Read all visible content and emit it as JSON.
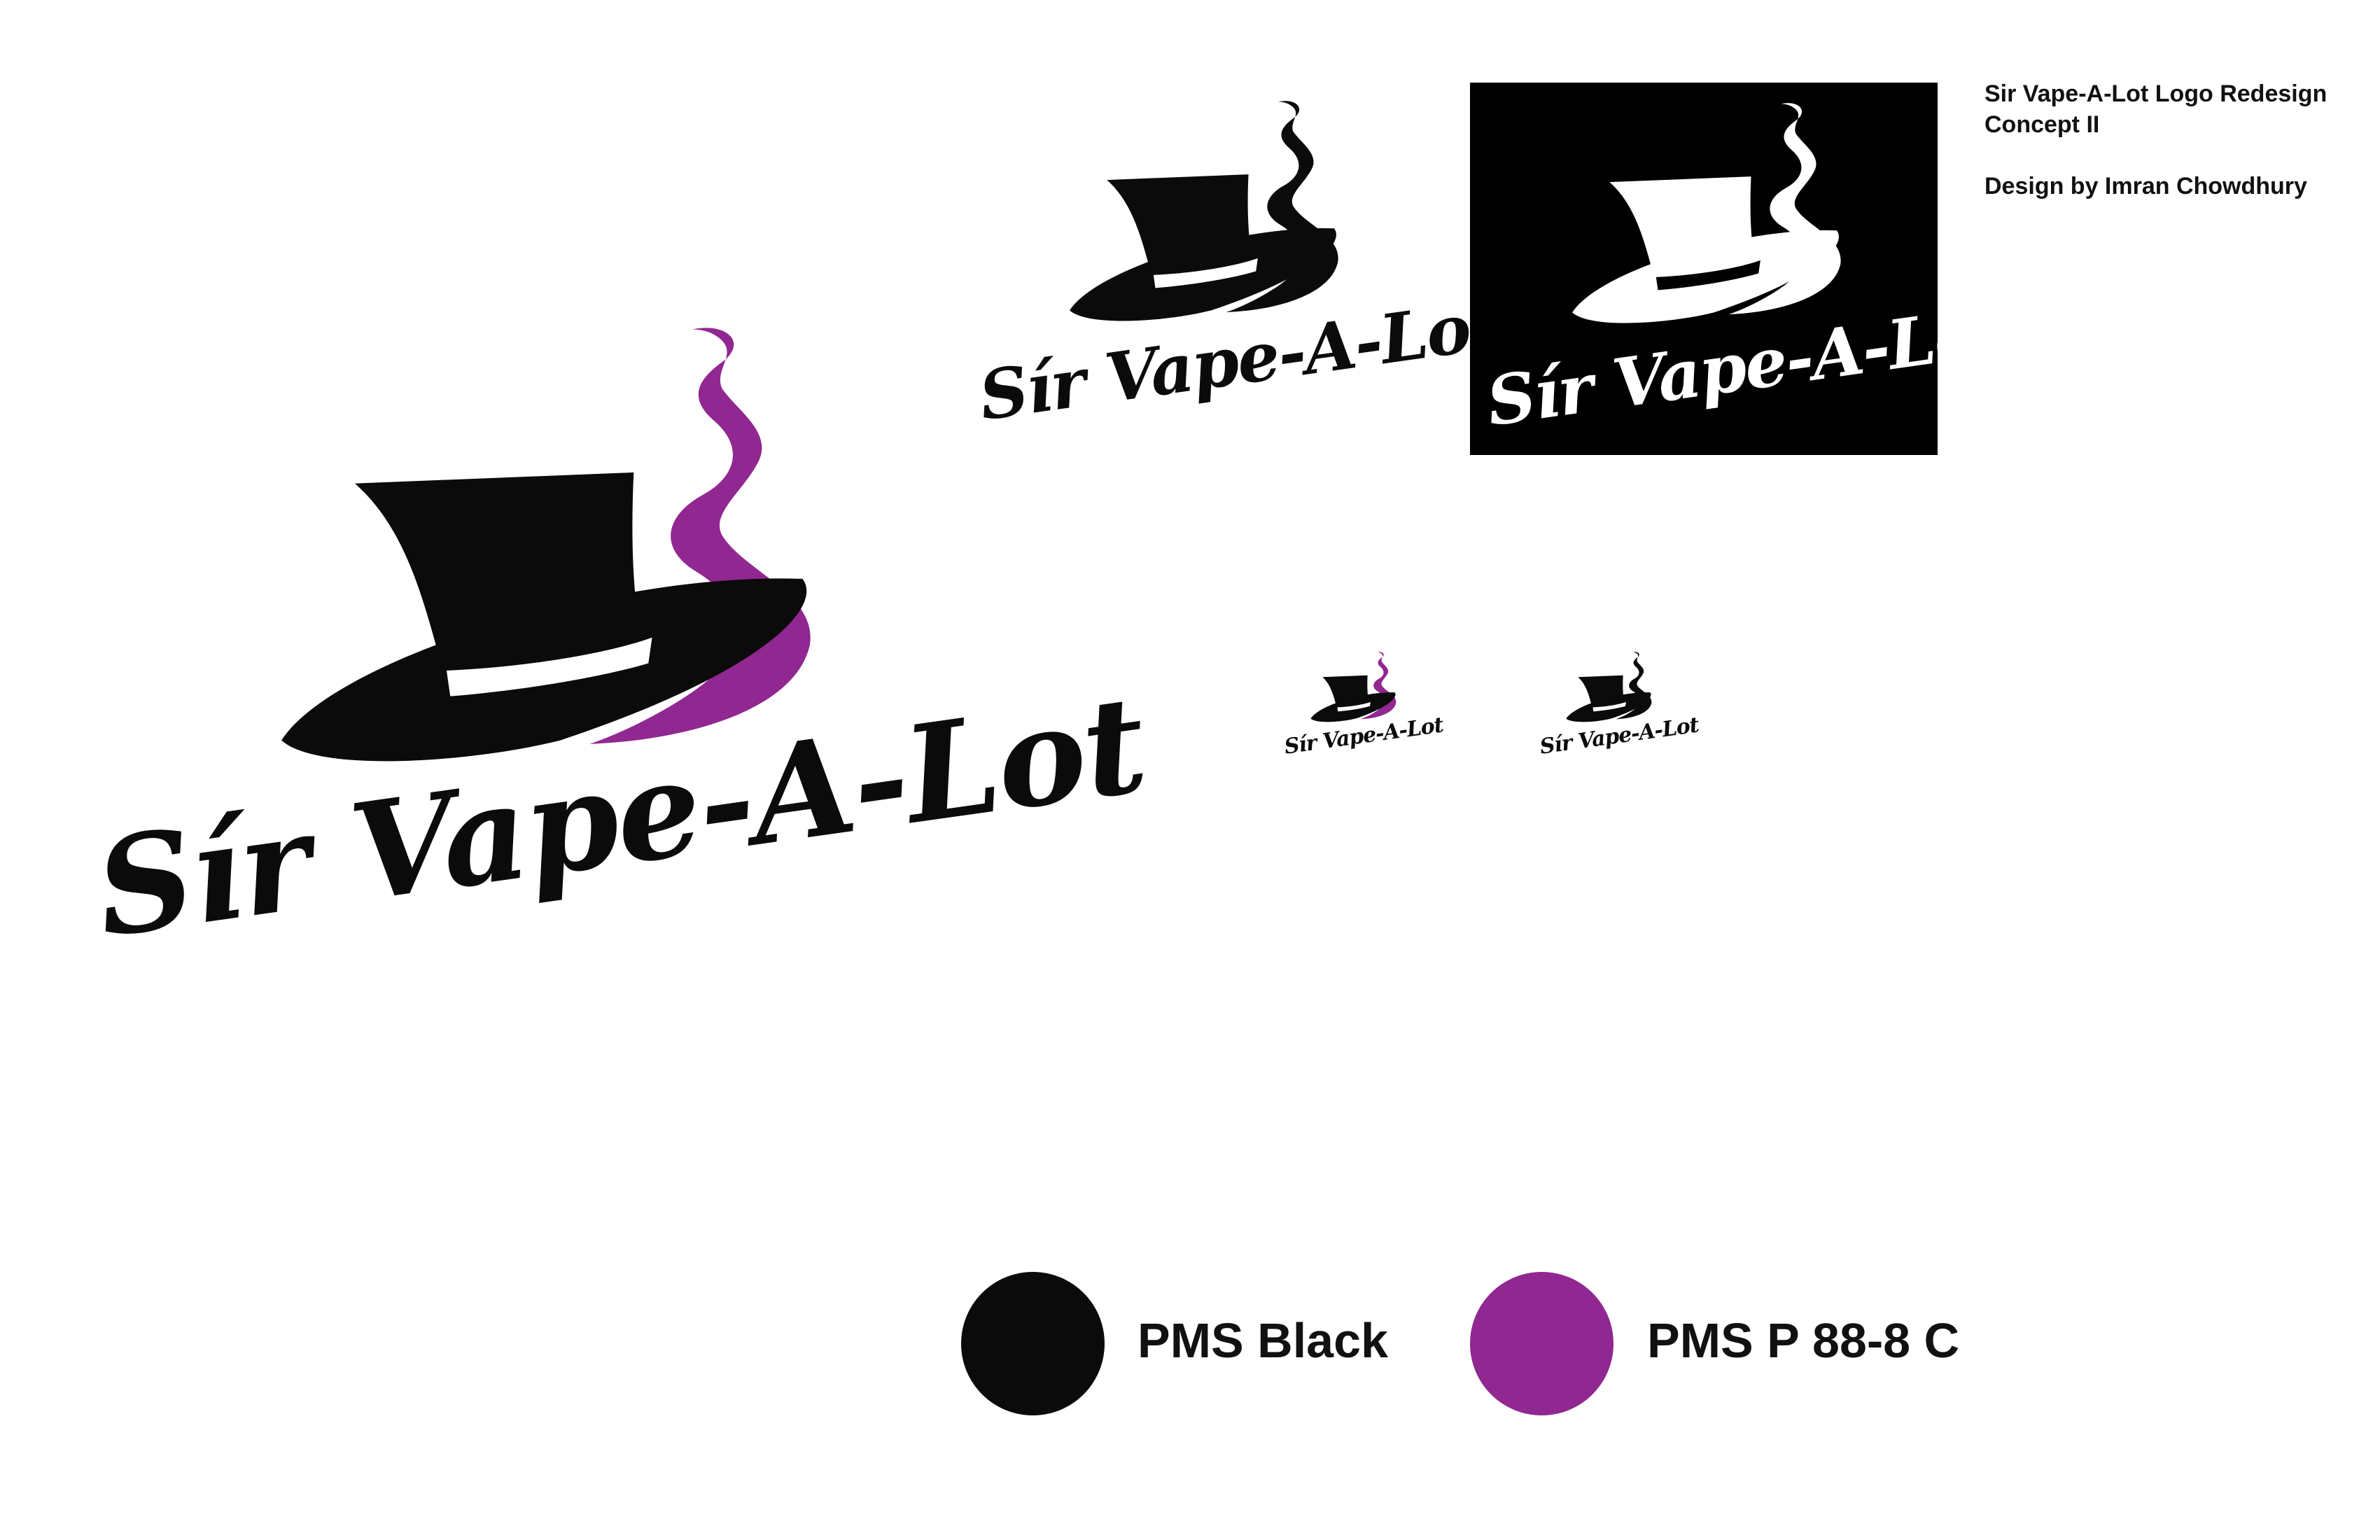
{
  "colors": {
    "black": "#0b0b0b",
    "purple": "#912791",
    "background": "#ffffff",
    "panel": "#000000"
  },
  "logo": {
    "wordmark": "Sír Vape-A-Lot",
    "icon": "top-hat-with-smoke-icon"
  },
  "variants": [
    {
      "name": "full-color-large"
    },
    {
      "name": "black-on-white"
    },
    {
      "name": "white-on-black"
    },
    {
      "name": "full-color-small"
    },
    {
      "name": "black-small"
    }
  ],
  "info": {
    "title": "Sir Vape-A-Lot Logo Redesign",
    "subtitle": "Concept II",
    "credit": "Design by Imran Chowdhury"
  },
  "palette": [
    {
      "label": "PMS Black",
      "color": "#0b0b0b"
    },
    {
      "label": "PMS P 88-8 C",
      "color": "#912791"
    }
  ]
}
